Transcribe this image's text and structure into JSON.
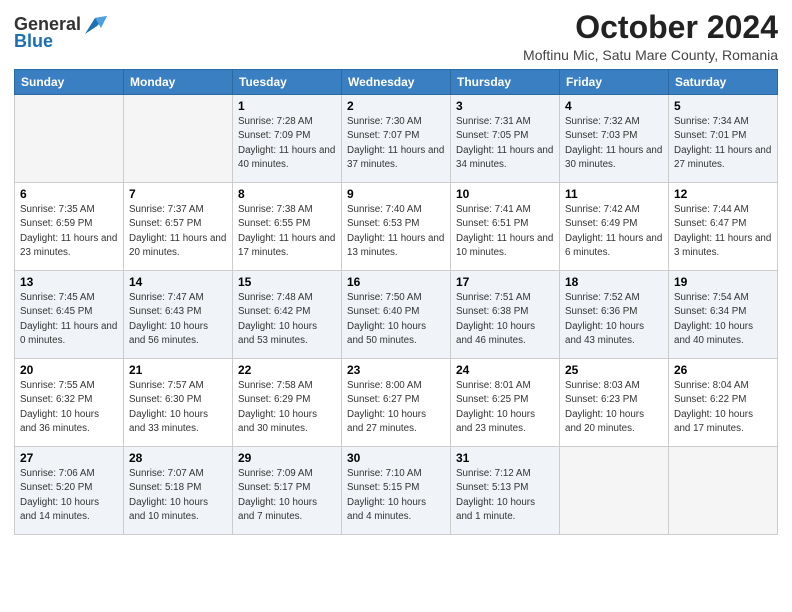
{
  "header": {
    "logo_general": "General",
    "logo_blue": "Blue",
    "month_title": "October 2024",
    "location": "Moftinu Mic, Satu Mare County, Romania"
  },
  "weekdays": [
    "Sunday",
    "Monday",
    "Tuesday",
    "Wednesday",
    "Thursday",
    "Friday",
    "Saturday"
  ],
  "weeks": [
    [
      {
        "day": "",
        "info": ""
      },
      {
        "day": "",
        "info": ""
      },
      {
        "day": "1",
        "info": "Sunrise: 7:28 AM\nSunset: 7:09 PM\nDaylight: 11 hours and 40 minutes."
      },
      {
        "day": "2",
        "info": "Sunrise: 7:30 AM\nSunset: 7:07 PM\nDaylight: 11 hours and 37 minutes."
      },
      {
        "day": "3",
        "info": "Sunrise: 7:31 AM\nSunset: 7:05 PM\nDaylight: 11 hours and 34 minutes."
      },
      {
        "day": "4",
        "info": "Sunrise: 7:32 AM\nSunset: 7:03 PM\nDaylight: 11 hours and 30 minutes."
      },
      {
        "day": "5",
        "info": "Sunrise: 7:34 AM\nSunset: 7:01 PM\nDaylight: 11 hours and 27 minutes."
      }
    ],
    [
      {
        "day": "6",
        "info": "Sunrise: 7:35 AM\nSunset: 6:59 PM\nDaylight: 11 hours and 23 minutes."
      },
      {
        "day": "7",
        "info": "Sunrise: 7:37 AM\nSunset: 6:57 PM\nDaylight: 11 hours and 20 minutes."
      },
      {
        "day": "8",
        "info": "Sunrise: 7:38 AM\nSunset: 6:55 PM\nDaylight: 11 hours and 17 minutes."
      },
      {
        "day": "9",
        "info": "Sunrise: 7:40 AM\nSunset: 6:53 PM\nDaylight: 11 hours and 13 minutes."
      },
      {
        "day": "10",
        "info": "Sunrise: 7:41 AM\nSunset: 6:51 PM\nDaylight: 11 hours and 10 minutes."
      },
      {
        "day": "11",
        "info": "Sunrise: 7:42 AM\nSunset: 6:49 PM\nDaylight: 11 hours and 6 minutes."
      },
      {
        "day": "12",
        "info": "Sunrise: 7:44 AM\nSunset: 6:47 PM\nDaylight: 11 hours and 3 minutes."
      }
    ],
    [
      {
        "day": "13",
        "info": "Sunrise: 7:45 AM\nSunset: 6:45 PM\nDaylight: 11 hours and 0 minutes."
      },
      {
        "day": "14",
        "info": "Sunrise: 7:47 AM\nSunset: 6:43 PM\nDaylight: 10 hours and 56 minutes."
      },
      {
        "day": "15",
        "info": "Sunrise: 7:48 AM\nSunset: 6:42 PM\nDaylight: 10 hours and 53 minutes."
      },
      {
        "day": "16",
        "info": "Sunrise: 7:50 AM\nSunset: 6:40 PM\nDaylight: 10 hours and 50 minutes."
      },
      {
        "day": "17",
        "info": "Sunrise: 7:51 AM\nSunset: 6:38 PM\nDaylight: 10 hours and 46 minutes."
      },
      {
        "day": "18",
        "info": "Sunrise: 7:52 AM\nSunset: 6:36 PM\nDaylight: 10 hours and 43 minutes."
      },
      {
        "day": "19",
        "info": "Sunrise: 7:54 AM\nSunset: 6:34 PM\nDaylight: 10 hours and 40 minutes."
      }
    ],
    [
      {
        "day": "20",
        "info": "Sunrise: 7:55 AM\nSunset: 6:32 PM\nDaylight: 10 hours and 36 minutes."
      },
      {
        "day": "21",
        "info": "Sunrise: 7:57 AM\nSunset: 6:30 PM\nDaylight: 10 hours and 33 minutes."
      },
      {
        "day": "22",
        "info": "Sunrise: 7:58 AM\nSunset: 6:29 PM\nDaylight: 10 hours and 30 minutes."
      },
      {
        "day": "23",
        "info": "Sunrise: 8:00 AM\nSunset: 6:27 PM\nDaylight: 10 hours and 27 minutes."
      },
      {
        "day": "24",
        "info": "Sunrise: 8:01 AM\nSunset: 6:25 PM\nDaylight: 10 hours and 23 minutes."
      },
      {
        "day": "25",
        "info": "Sunrise: 8:03 AM\nSunset: 6:23 PM\nDaylight: 10 hours and 20 minutes."
      },
      {
        "day": "26",
        "info": "Sunrise: 8:04 AM\nSunset: 6:22 PM\nDaylight: 10 hours and 17 minutes."
      }
    ],
    [
      {
        "day": "27",
        "info": "Sunrise: 7:06 AM\nSunset: 5:20 PM\nDaylight: 10 hours and 14 minutes."
      },
      {
        "day": "28",
        "info": "Sunrise: 7:07 AM\nSunset: 5:18 PM\nDaylight: 10 hours and 10 minutes."
      },
      {
        "day": "29",
        "info": "Sunrise: 7:09 AM\nSunset: 5:17 PM\nDaylight: 10 hours and 7 minutes."
      },
      {
        "day": "30",
        "info": "Sunrise: 7:10 AM\nSunset: 5:15 PM\nDaylight: 10 hours and 4 minutes."
      },
      {
        "day": "31",
        "info": "Sunrise: 7:12 AM\nSunset: 5:13 PM\nDaylight: 10 hours and 1 minute."
      },
      {
        "day": "",
        "info": ""
      },
      {
        "day": "",
        "info": ""
      }
    ]
  ]
}
